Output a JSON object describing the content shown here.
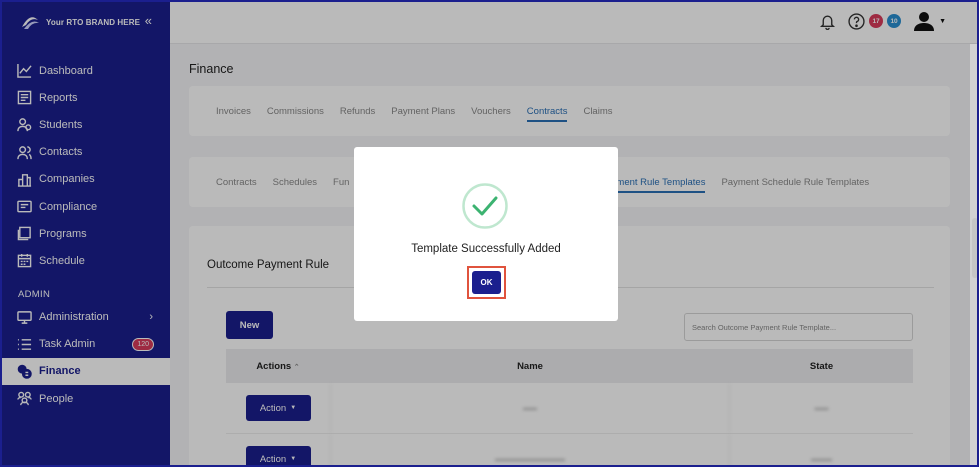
{
  "brand": {
    "name": "Your RTO BRAND HERE"
  },
  "sidebar": {
    "items": [
      {
        "label": "Dashboard",
        "icon": "chart-line-icon"
      },
      {
        "label": "Reports",
        "icon": "report-icon"
      },
      {
        "label": "Students",
        "icon": "students-icon"
      },
      {
        "label": "Contacts",
        "icon": "contacts-icon"
      },
      {
        "label": "Companies",
        "icon": "companies-icon"
      },
      {
        "label": "Compliance",
        "icon": "compliance-icon"
      },
      {
        "label": "Programs",
        "icon": "programs-icon"
      },
      {
        "label": "Schedule",
        "icon": "calendar-icon"
      }
    ],
    "admin_header": "ADMIN",
    "admin_items": [
      {
        "label": "Administration",
        "icon": "monitor-icon"
      },
      {
        "label": "Task Admin",
        "icon": "list-icon",
        "badge": "120"
      },
      {
        "label": "Finance",
        "icon": "finance-icon",
        "active": true
      },
      {
        "label": "People",
        "icon": "people-icon"
      }
    ]
  },
  "header": {
    "badge_red": "17",
    "badge_blue": "10"
  },
  "page": {
    "title": "Finance",
    "tabs": [
      "Invoices",
      "Commissions",
      "Refunds",
      "Payment Plans",
      "Vouchers",
      "Contracts",
      "Claims"
    ],
    "active_tab": "Contracts",
    "subtabs": [
      "Contracts",
      "Schedules",
      "Fun",
      "ment Rule Templates",
      "Payment Schedule Rule Templates"
    ],
    "section_title": "Outcome Payment Rule",
    "new_button": "New",
    "search_placeholder": "Search Outcome Payment Rule Template...",
    "table": {
      "headers": [
        "Actions",
        "Name",
        "State"
      ],
      "action_label": "Action"
    }
  },
  "modal": {
    "message": "Template Successfully Added",
    "ok_label": "OK"
  },
  "colors": {
    "primary": "#1b1f8e",
    "success": "#3cb371",
    "highlight": "#e0533d"
  }
}
